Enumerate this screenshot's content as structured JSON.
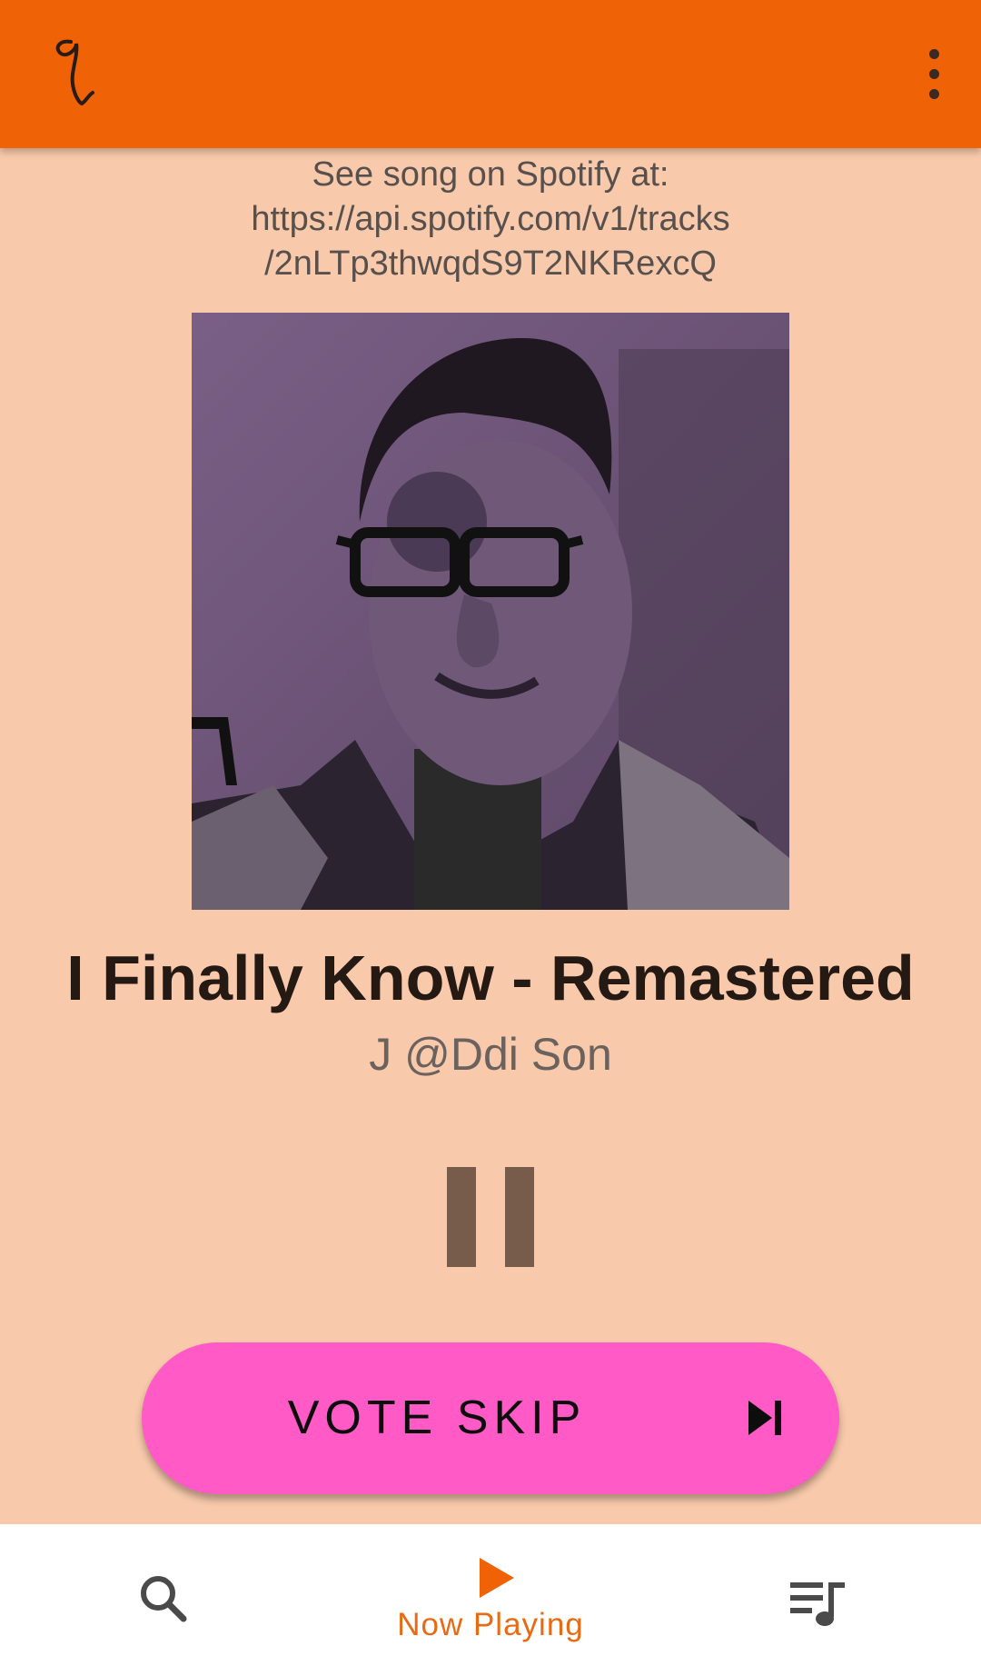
{
  "app": {
    "logo_icon": "quaver-note-icon",
    "menu_icon": "more-vert-icon",
    "accent_color": "#ef6206"
  },
  "spotify": {
    "lines": [
      "See song on Spotify at:",
      "https://api.spotify.com/v1/tracks",
      "/2nLTp3thwqdS9T2NKRexcQ"
    ]
  },
  "track": {
    "title": "I Finally Know - Remastered",
    "artist": "J @Ddi Son",
    "album_art": "album-art-portrait"
  },
  "controls": {
    "play_state_icon": "pause-icon",
    "vote_skip_label": "VOTE SKIP",
    "vote_skip_icon": "skip-next-icon",
    "vote_skip_color": "#ff5ac5"
  },
  "bottom_nav": {
    "items": [
      {
        "icon": "search-icon",
        "label": ""
      },
      {
        "icon": "play-icon",
        "label": "Now Playing",
        "active": true
      },
      {
        "icon": "queue-music-icon",
        "label": ""
      }
    ],
    "active_color": "#e86a12"
  }
}
